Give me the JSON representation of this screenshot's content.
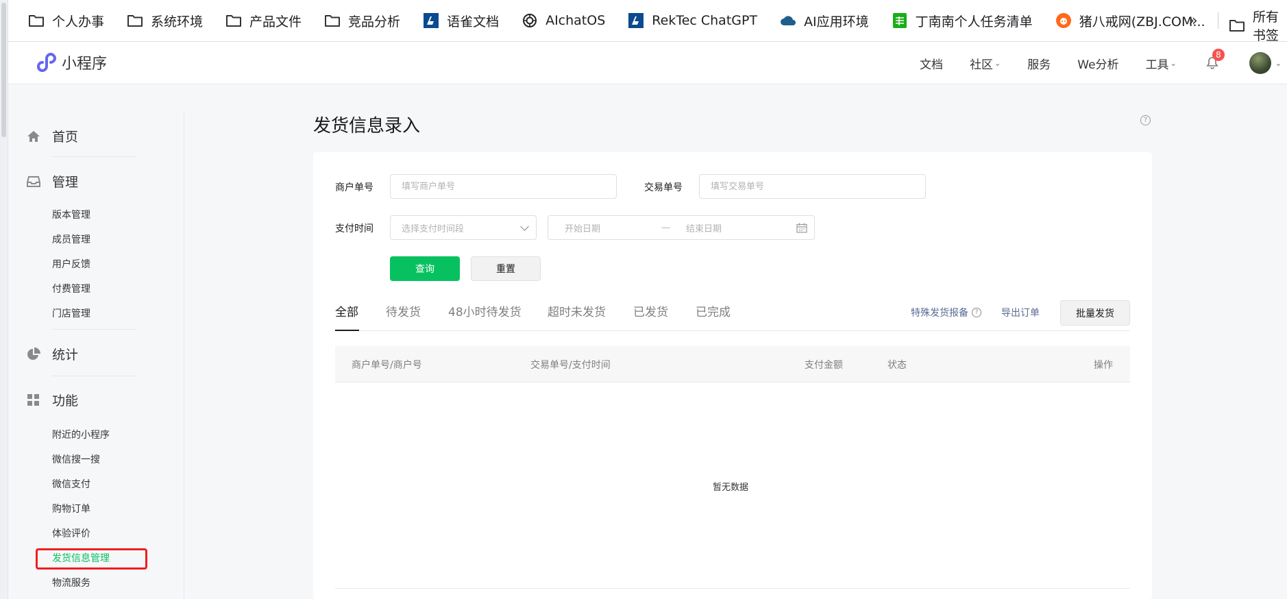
{
  "bookmarks": [
    {
      "label": "个人办事",
      "icon": "folder-icon"
    },
    {
      "label": "系统环境",
      "icon": "folder-icon"
    },
    {
      "label": "产品文件",
      "icon": "folder-icon"
    },
    {
      "label": "竞品分析",
      "icon": "folder-icon"
    },
    {
      "label": "语雀文档",
      "icon": "yuque-icon"
    },
    {
      "label": "AIchatOS",
      "icon": "openai-icon"
    },
    {
      "label": "RekTec ChatGPT",
      "icon": "rektec-icon"
    },
    {
      "label": "AI应用环境",
      "icon": "cloud-icon"
    },
    {
      "label": "丁南南个人任务清单",
      "icon": "sheet-icon"
    },
    {
      "label": "猪八戒网(ZBJ.COM...",
      "icon": "zbj-icon"
    }
  ],
  "bookmarks_more": "»",
  "bookmarks_all": "所有书签",
  "brand": {
    "name": "小程序"
  },
  "nav": {
    "docs": "文档",
    "community": "社区",
    "service": "服务",
    "we_analysis": "We分析",
    "tools": "工具",
    "notification_count": "8"
  },
  "sidebar": {
    "groups": [
      {
        "label": "首页",
        "icon": "home-icon"
      },
      {
        "label": "管理",
        "icon": "inbox-icon",
        "items": [
          "版本管理",
          "成员管理",
          "用户反馈",
          "付费管理",
          "门店管理"
        ]
      },
      {
        "label": "统计",
        "icon": "pie-chart-icon"
      },
      {
        "label": "功能",
        "icon": "grid-icon",
        "items": [
          "附近的小程序",
          "微信搜一搜",
          "微信支付",
          "购物订单",
          "体验评价",
          "发货信息管理",
          "物流服务"
        ]
      }
    ],
    "active_item": "发货信息管理"
  },
  "page": {
    "title": "发货信息录入",
    "help": "?"
  },
  "filters": {
    "merchant_no_label": "商户单号",
    "merchant_no_placeholder": "填写商户单号",
    "trade_no_label": "交易单号",
    "trade_no_placeholder": "填写交易单号",
    "pay_time_label": "支付时间",
    "pay_time_placeholder": "选择支付时间段",
    "start_date_placeholder": "开始日期",
    "date_separator": "—",
    "end_date_placeholder": "结束日期"
  },
  "buttons": {
    "query": "查询",
    "reset": "重置",
    "batch_ship": "批量发货"
  },
  "tabs": [
    "全部",
    "待发货",
    "48小时待发货",
    "超时未发货",
    "已发货",
    "已完成"
  ],
  "active_tab": "全部",
  "links": {
    "special_report": "特殊发货报备",
    "export_orders": "导出订单"
  },
  "table": {
    "columns": [
      "商户单号/商户号",
      "交易单号/支付时间",
      "支付金额",
      "状态",
      "操作"
    ],
    "empty_text": "暂无数据"
  },
  "colors": {
    "accent": "#07c160",
    "link": "#576b95",
    "highlight_border": "#f01e1e",
    "badge": "#fa5151"
  }
}
